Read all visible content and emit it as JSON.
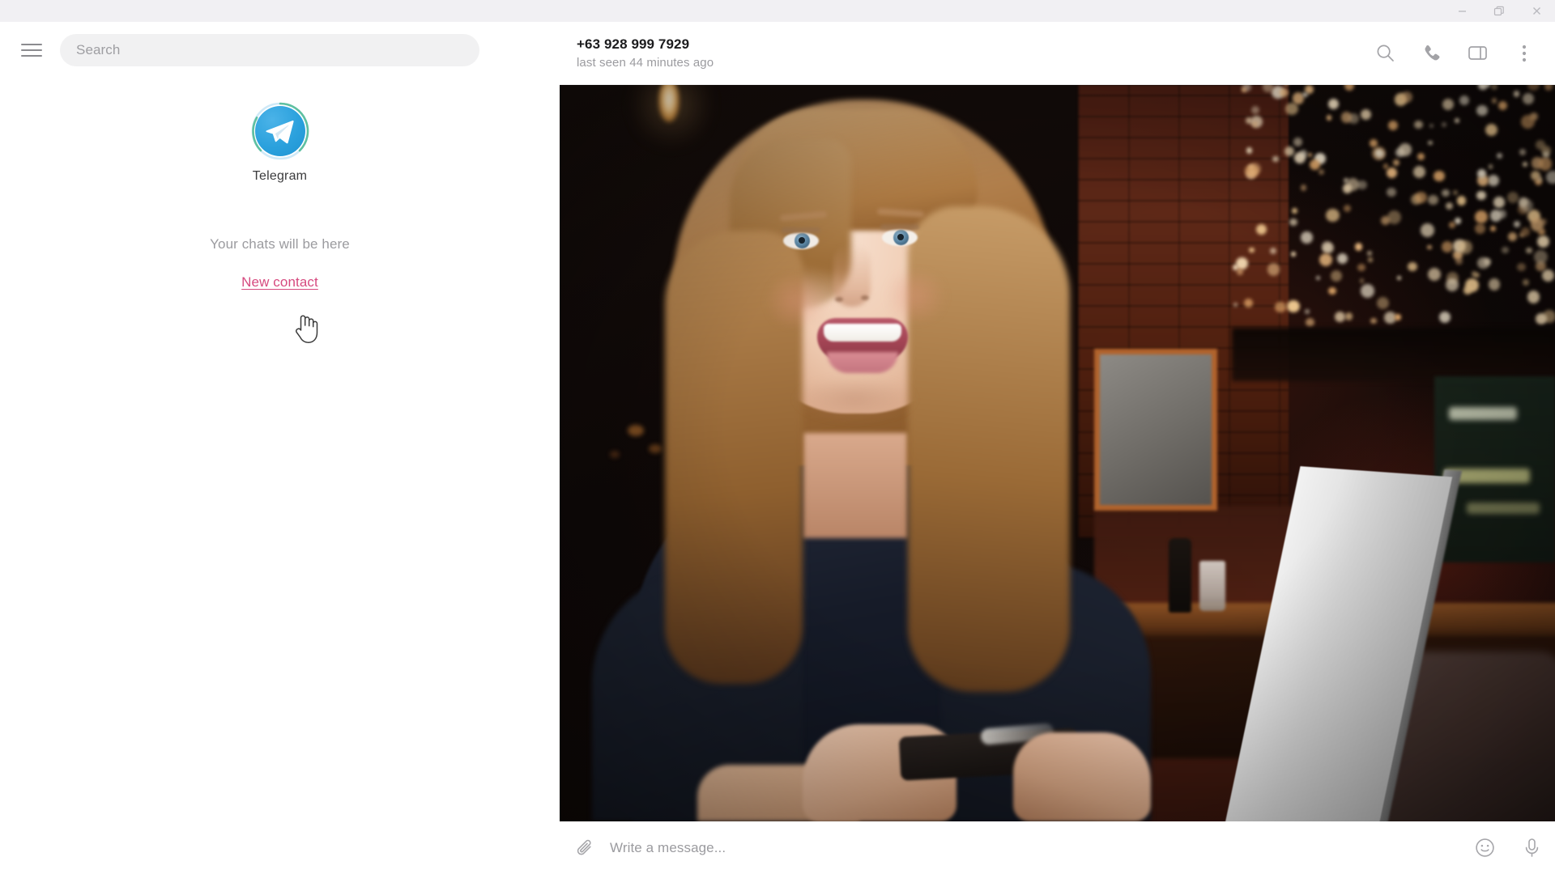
{
  "window": {
    "minimize_label": "Minimize",
    "restore_label": "Restore",
    "close_label": "Close"
  },
  "sidebar": {
    "menu_label": "Menu",
    "search": {
      "placeholder": "Search",
      "value": ""
    },
    "empty_state": {
      "app_name": "Telegram",
      "hint": "Your chats will be here",
      "new_contact_link": "New contact"
    }
  },
  "chat": {
    "peer_name": "+63 928 999 7929",
    "peer_status": "last seen 44 minutes ago",
    "actions": [
      {
        "name": "search-icon",
        "label": "Search messages"
      },
      {
        "name": "phone-icon",
        "label": "Call"
      },
      {
        "name": "panel-toggle-icon",
        "label": "Toggle info panel"
      },
      {
        "name": "more-vertical-icon",
        "label": "More"
      }
    ]
  },
  "compose": {
    "attach_label": "Attach file",
    "placeholder": "Write a message...",
    "value": "",
    "emoji_label": "Emoji",
    "voice_label": "Record voice message"
  },
  "colors": {
    "titlebar": "#f1f0f3",
    "brand_blue": "#2ba1dd",
    "link_pink": "#d64a7f",
    "muted_text": "#9b9b9f",
    "search_field": "#f1f1f2"
  }
}
